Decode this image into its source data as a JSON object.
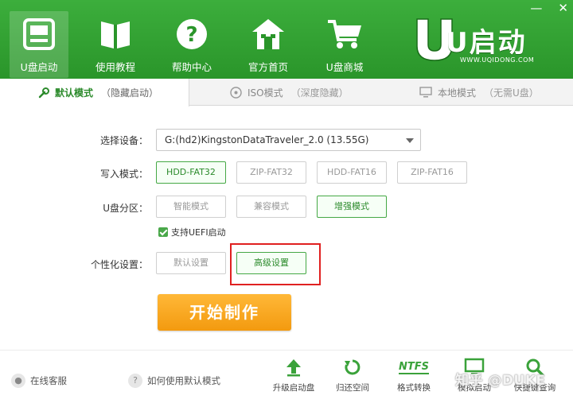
{
  "window": {
    "minimize": "—",
    "close": "✕"
  },
  "nav": [
    {
      "label": "U盘启动",
      "icon": "usb-drive-icon"
    },
    {
      "label": "使用教程",
      "icon": "book-icon"
    },
    {
      "label": "帮助中心",
      "icon": "help-icon"
    },
    {
      "label": "官方首页",
      "icon": "home-icon"
    },
    {
      "label": "U盘商城",
      "icon": "cart-icon"
    }
  ],
  "logo": {
    "text": "U启动",
    "url": "WWW.UQIDONG.COM"
  },
  "tabs": [
    {
      "label": "默认模式",
      "sub": "（隐藏启动）"
    },
    {
      "label": "ISO模式",
      "sub": "（深度隐藏）"
    },
    {
      "label": "本地模式",
      "sub": "（无需U盘）"
    }
  ],
  "form": {
    "device_label": "选择设备：",
    "device_value": "G:(hd2)KingstonDataTraveler_2.0 (13.55G)",
    "write_label": "写入模式：",
    "write_options": [
      "HDD-FAT32",
      "ZIP-FAT32",
      "HDD-FAT16",
      "ZIP-FAT16"
    ],
    "partition_label": "U盘分区：",
    "partition_options": [
      "智能模式",
      "兼容模式",
      "增强模式"
    ],
    "uefi_label": "支持UEFI启动",
    "custom_label": "个性化设置：",
    "custom_options": [
      "默认设置",
      "高级设置"
    ],
    "start_button": "开始制作"
  },
  "footer": {
    "online_service": "在线客服",
    "how_to": "如何使用默认模式",
    "tools": [
      {
        "label": "升级启动盘",
        "icon": "upload-arrow-icon"
      },
      {
        "label": "归还空间",
        "icon": "restore-icon"
      },
      {
        "label": "格式转换",
        "icon": "ntfs-icon",
        "icon_text": "NTFS"
      },
      {
        "label": "模拟启动",
        "icon": "monitor-icon"
      },
      {
        "label": "快捷键查询",
        "icon": "search-icon"
      }
    ],
    "watermark": "知乎 @DUKE"
  },
  "colors": {
    "brand_green": "#2f9e2f",
    "start_orange": "#f5a21b",
    "highlight_red": "#e02020"
  }
}
